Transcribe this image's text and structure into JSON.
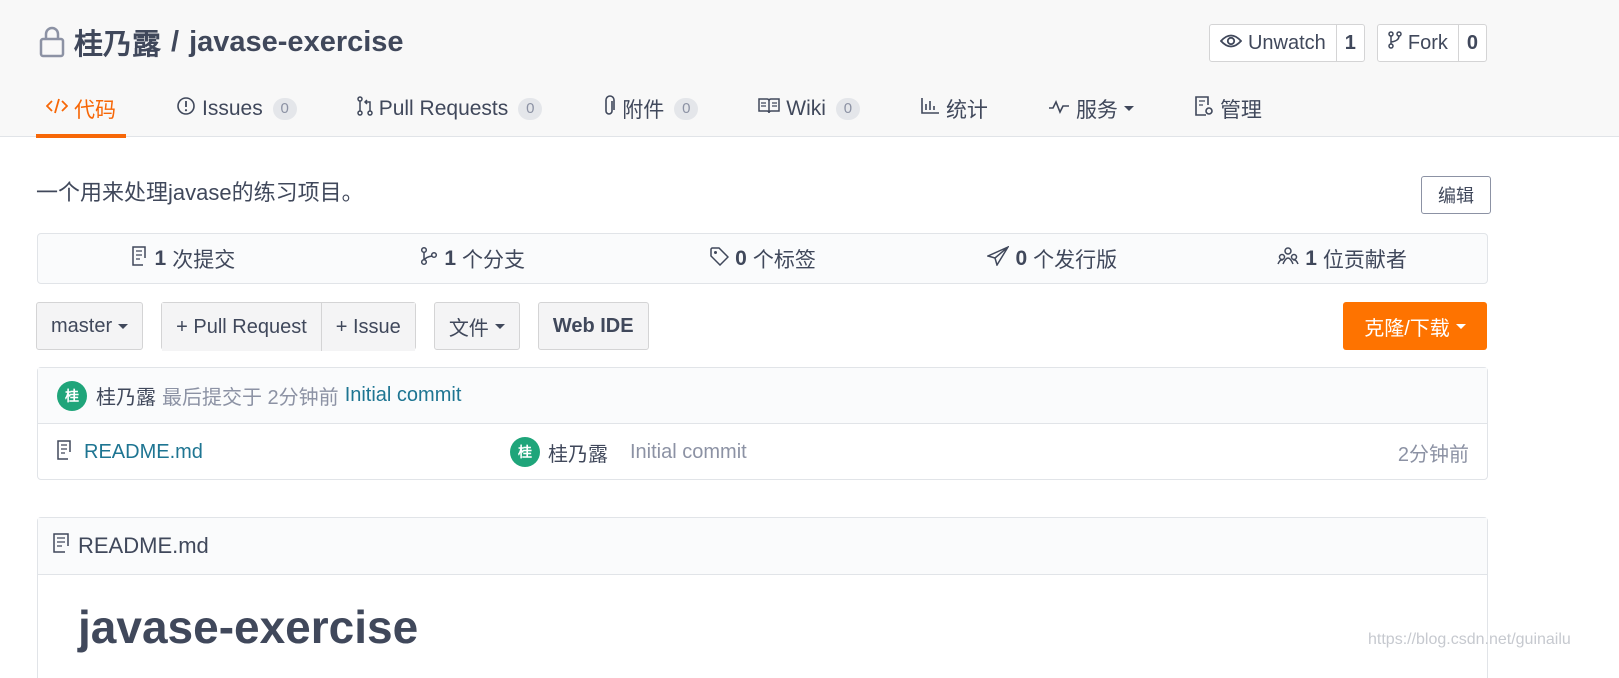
{
  "repo": {
    "owner": "桂乃露",
    "separator": "/",
    "name": "javase-exercise"
  },
  "actions": {
    "watch_label": "Unwatch",
    "watch_count": "1",
    "fork_label": "Fork",
    "fork_count": "0"
  },
  "tabs": [
    {
      "label": "代码",
      "icon": "code-icon",
      "active": true
    },
    {
      "label": "Issues",
      "icon": "issue-icon",
      "badge": "0"
    },
    {
      "label": "Pull Requests",
      "icon": "pull-request-icon",
      "badge": "0"
    },
    {
      "label": "附件",
      "icon": "paperclip-icon",
      "badge": "0"
    },
    {
      "label": "Wiki",
      "icon": "book-icon",
      "badge": "0"
    },
    {
      "label": "统计",
      "icon": "bar-chart-icon"
    },
    {
      "label": "服务",
      "icon": "pulse-icon"
    },
    {
      "label": "管理",
      "icon": "settings-doc-icon"
    }
  ],
  "description": "一个用来处理javase的练习项目。",
  "edit_label": "编辑",
  "stats": [
    {
      "count": "1",
      "label": "次提交",
      "icon": "commit-icon"
    },
    {
      "count": "1",
      "label": "个分支",
      "icon": "branch-icon"
    },
    {
      "count": "0",
      "label": "个标签",
      "icon": "tag-icon"
    },
    {
      "count": "0",
      "label": "个发行版",
      "icon": "send-icon"
    },
    {
      "count": "1",
      "label": "位贡献者",
      "icon": "contributors-icon"
    }
  ],
  "toolbar": {
    "branch": "master",
    "pull_request": "+ Pull Request",
    "issue": "+ Issue",
    "file": "文件",
    "web_ide": "Web IDE",
    "clone": "克隆/下载"
  },
  "last_commit": {
    "avatar_initial": "桂",
    "author": "桂乃露",
    "meta": "最后提交于 2分钟前",
    "message": "Initial commit"
  },
  "files": [
    {
      "name": "README.md",
      "avatar_initial": "桂",
      "author": "桂乃露",
      "message": "Initial commit",
      "time": "2分钟前"
    }
  ],
  "readme": {
    "file_name": "README.md",
    "heading": "javase-exercise"
  },
  "watermark": "https://blog.csdn.net/guinailu",
  "colors": {
    "accent": "#f76707",
    "clone_button": "#fe7300",
    "link": "#1e7592",
    "avatar": "#1fa57a"
  }
}
